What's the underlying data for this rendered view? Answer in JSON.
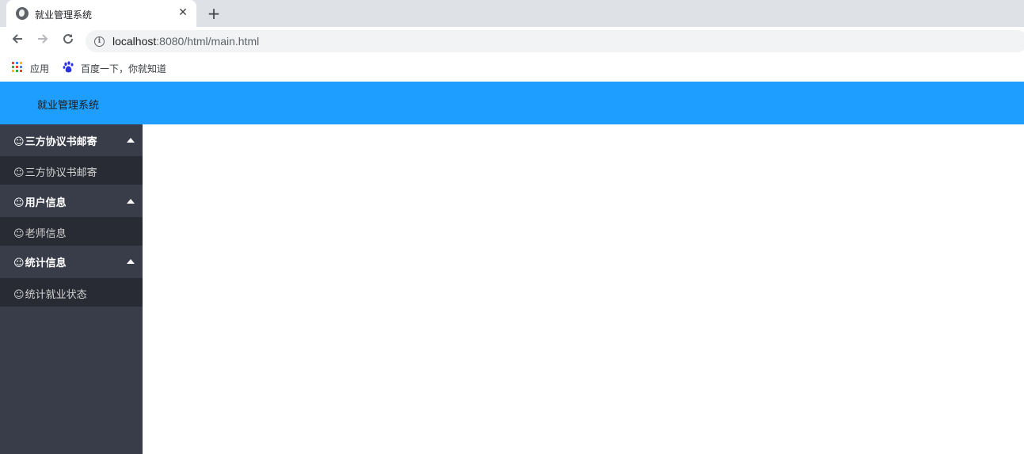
{
  "browser": {
    "tab_title": "就业管理系统",
    "tab_close": "✕",
    "new_tab": "+",
    "url_host": "localhost",
    "url_rest": ":8080/html/main.html",
    "bookmarks": [
      {
        "label": "应用"
      },
      {
        "label": "百度一下，你就知道"
      }
    ]
  },
  "app": {
    "title": "就业管理系统",
    "sidebar": {
      "icon_glyph": "☺",
      "groups": [
        {
          "label": "三方协议书邮寄",
          "items": [
            {
              "label": "三方协议书邮寄"
            }
          ]
        },
        {
          "label": "用户信息",
          "items": [
            {
              "label": "老师信息"
            }
          ]
        },
        {
          "label": "统计信息",
          "items": [
            {
              "label": "统计就业状态"
            }
          ]
        }
      ]
    }
  },
  "colors": {
    "header": "#1e9fff",
    "sidebar": "#393d49",
    "sub_item": "#282b33"
  }
}
